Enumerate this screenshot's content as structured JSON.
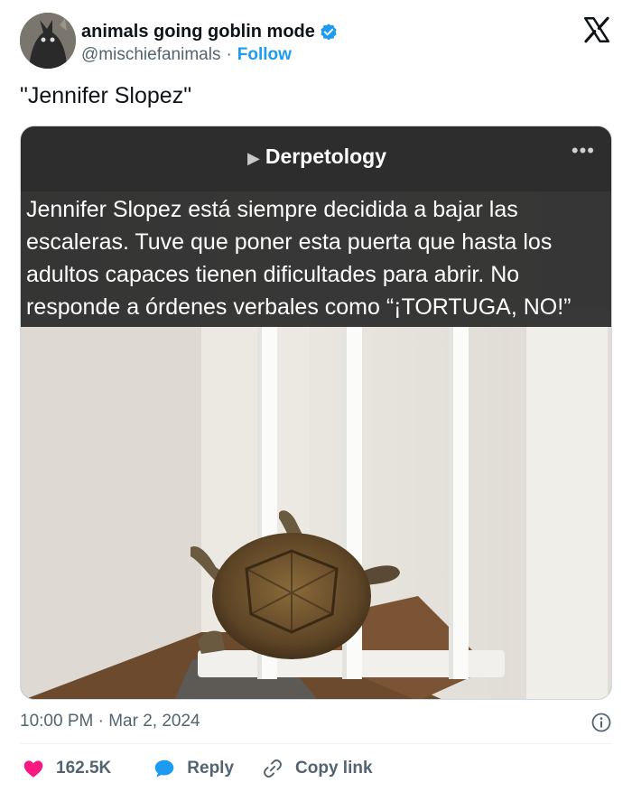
{
  "author": {
    "name": "animals going goblin mode",
    "handle": "@mischiefanimals",
    "separator": "·",
    "follow_label": "Follow"
  },
  "tweet": {
    "text": "\"Jennifer Slopez\""
  },
  "media": {
    "subreddit": "Derpetology",
    "more_label": "•••",
    "caption": "Jennifer Slopez está siempre decidida a bajar las escaleras. Tuve que poner esta puerta que hasta los adultos capaces tienen dificultades para abrir. No responde a órdenes verbales como “¡TORTUGA, NO!”"
  },
  "meta": {
    "time": "10:00 PM",
    "separator": "·",
    "date": "Mar 2, 2024"
  },
  "actions": {
    "likes": "162.5K",
    "reply_label": "Reply",
    "copy_label": "Copy link"
  },
  "colors": {
    "accent": "#1d9bf0",
    "heart": "#f91880",
    "muted": "#536471"
  }
}
